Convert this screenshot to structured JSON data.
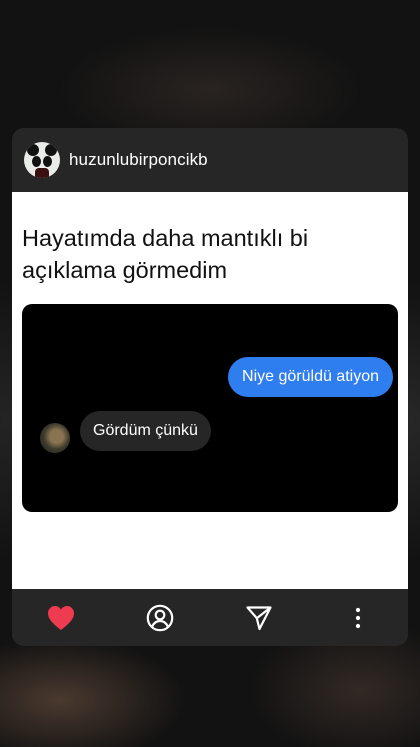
{
  "post": {
    "username": "huzunlubirponcikb",
    "caption": "Hayatımda daha mantıklı bi açıklama görmedim"
  },
  "chat": {
    "sent_message": "Niye görüldü atiyon",
    "received_message": "Gördüm çünkü"
  },
  "footer": {
    "icons": [
      "heart-icon",
      "profile-icon",
      "send-icon",
      "more-icon"
    ]
  },
  "colors": {
    "like": "#ef3b4f",
    "sent_bubble": "#2f7ef0",
    "received_bubble": "#262626",
    "card_bar": "#262626"
  }
}
